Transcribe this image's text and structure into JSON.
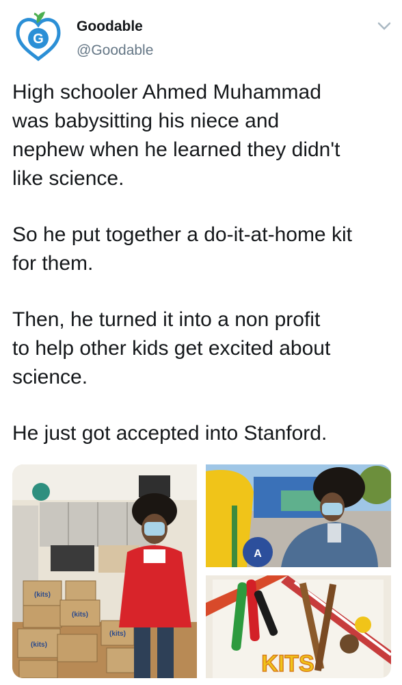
{
  "account": {
    "display_name": "Goodable",
    "handle": "@Goodable",
    "avatar_letter": "G",
    "avatar_icon": "heart-apple-logo"
  },
  "tweet": {
    "paragraphs": [
      "High schooler Ahmed Muhammad\nwas babysitting his niece and\nnephew when he learned they didn't\nlike science.",
      "So he put together a do-it-at-home kit\nfor them.",
      "Then, he turned it into a non profit\nto help other kids get excited about\nscience.",
      "He just got accepted into Stanford."
    ]
  },
  "media": {
    "box_label": "(kits)",
    "photos": [
      {
        "name": "student-with-kit-boxes",
        "shows": "photo"
      },
      {
        "name": "student-at-playground",
        "shows": "photo"
      },
      {
        "name": "science-kit-contents",
        "shows": "photo"
      }
    ],
    "kit_sign_text": "KITS"
  },
  "colors": {
    "name": "#14171a",
    "handle": "#657786",
    "logo_blue": "#1da1f2",
    "logo_green": "#4caf50"
  }
}
